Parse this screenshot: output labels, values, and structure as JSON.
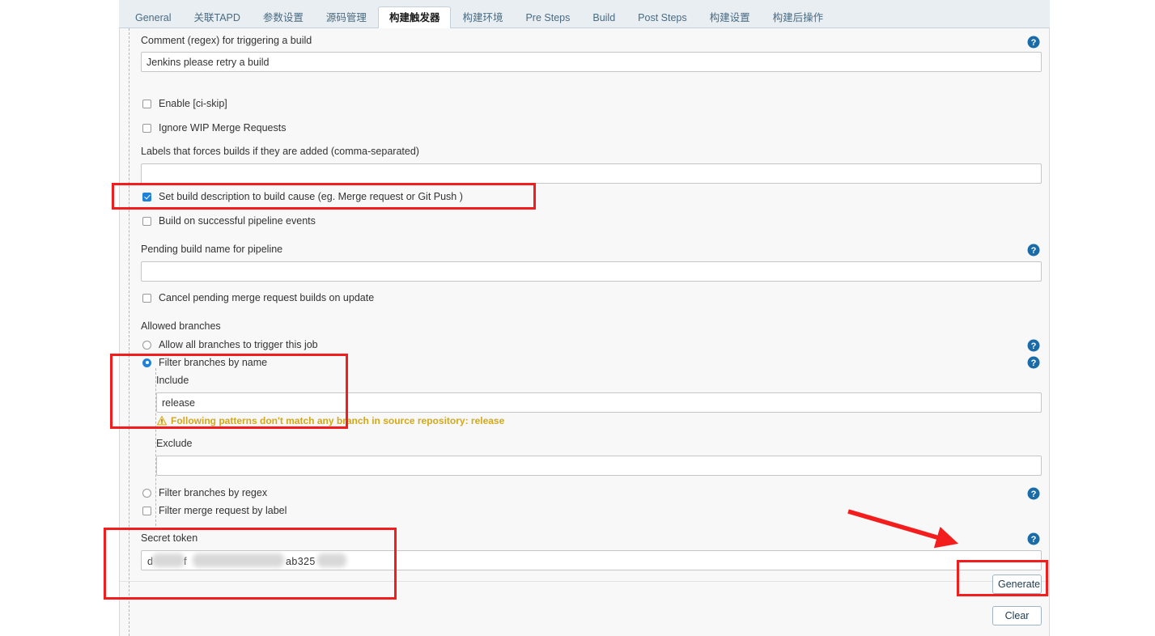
{
  "tabs": [
    {
      "label": "General",
      "active": false
    },
    {
      "label": "关联TAPD",
      "active": false
    },
    {
      "label": "参数设置",
      "active": false
    },
    {
      "label": "源码管理",
      "active": false
    },
    {
      "label": "构建触发器",
      "active": true
    },
    {
      "label": "构建环境",
      "active": false
    },
    {
      "label": "Pre Steps",
      "active": false
    },
    {
      "label": "Build",
      "active": false
    },
    {
      "label": "Post Steps",
      "active": false
    },
    {
      "label": "构建设置",
      "active": false
    },
    {
      "label": "构建后操作",
      "active": false
    }
  ],
  "form": {
    "comment_regex_label": "Comment (regex) for triggering a build",
    "comment_regex_value": "Jenkins please retry a build",
    "enable_ci_skip_label": "Enable [ci-skip]",
    "enable_ci_skip_checked": false,
    "ignore_wip_label": "Ignore WIP Merge Requests",
    "ignore_wip_checked": false,
    "labels_force_label": "Labels that forces builds if they are added (comma-separated)",
    "labels_force_value": "",
    "set_build_desc_label": "Set build description to build cause (eg. Merge request or Git Push )",
    "set_build_desc_checked": true,
    "build_on_pipeline_label": "Build on successful pipeline events",
    "build_on_pipeline_checked": false,
    "pending_build_name_label": "Pending build name for pipeline",
    "pending_build_name_value": "",
    "cancel_pending_label": "Cancel pending merge request builds on update",
    "cancel_pending_checked": false,
    "allowed_branches_label": "Allowed branches",
    "allow_all_label": "Allow all branches to trigger this job",
    "allow_all_selected": false,
    "filter_by_name_label": "Filter branches by name",
    "filter_by_name_selected": true,
    "include_label": "Include",
    "include_value": "release",
    "include_warning": "Following patterns don't match any branch in source repository: release",
    "exclude_label": "Exclude",
    "exclude_value": "",
    "filter_by_regex_label": "Filter branches by regex",
    "filter_by_regex_selected": false,
    "filter_by_mr_label_label": "Filter merge request by label",
    "filter_by_mr_label_checked": false,
    "secret_token_label": "Secret token",
    "secret_token_visible_prefix": "d",
    "secret_token_visible_middle": "f",
    "secret_token_visible_suffix": "ab325",
    "generate_button": "Generate",
    "clear_button": "Clear"
  },
  "help_icon_name": "help-question-icon",
  "colors": {
    "accent": "#1f82d9",
    "warning": "#d3a81c",
    "annotation": "#f41d1d",
    "panel_bg": "#f8f8f8",
    "tabbar_bg": "#e8eef2"
  }
}
